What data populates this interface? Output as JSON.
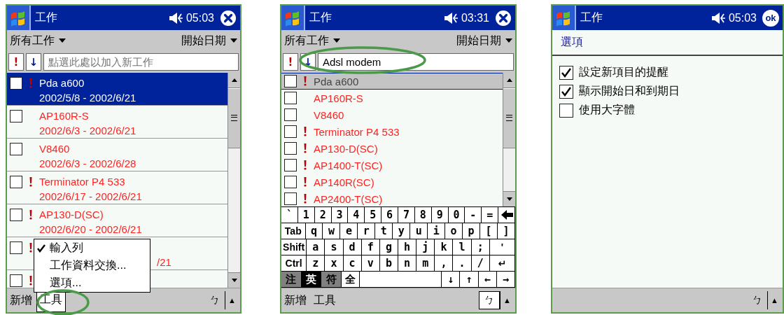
{
  "screens": [
    {
      "kind": "task-list",
      "list_active": true,
      "title_bar": {
        "title": "工作",
        "time": "05:03",
        "button": {
          "kind": "close"
        }
      },
      "filter_bar": {
        "category": "所有工作",
        "sort": "開始日期"
      },
      "entry_bar": {
        "priority_button": "!",
        "sort_button": "↓",
        "input": {
          "placeholder": "點選此處以加入新工作"
        }
      },
      "tasks": [
        {
          "kind": "full",
          "name": "Pda a600",
          "dates": "2002/5/8 - 2002/6/21",
          "important": true,
          "overdue": false,
          "checked": false,
          "selected": true
        },
        {
          "kind": "full",
          "name": "AP160R-S",
          "dates": "2002/6/3 - 2002/6/21",
          "important": false,
          "overdue": true,
          "checked": false,
          "selected": false
        },
        {
          "kind": "full",
          "name": "V8460",
          "dates": "2002/6/3 - 2002/6/28",
          "important": false,
          "overdue": true,
          "checked": false,
          "selected": false
        },
        {
          "kind": "full",
          "name": "Terminator P4 533",
          "dates": "2002/6/17 - 2002/6/21",
          "important": true,
          "overdue": true,
          "checked": false,
          "selected": false
        },
        {
          "kind": "full",
          "name": "AP130-D(SC)",
          "dates": "2002/6/20 - 2002/6/21",
          "important": true,
          "overdue": true,
          "checked": false,
          "selected": false
        },
        {
          "kind": "covered",
          "dates": "/21",
          "important": true,
          "overdue": true,
          "checked": false,
          "selected": false
        },
        {
          "kind": "covered",
          "important": true,
          "checked": false,
          "selected": false
        }
      ],
      "menu": {
        "items": [
          {
            "label": "輸入列",
            "checked": true
          },
          {
            "label": "工作資料交換...",
            "checked": false
          },
          {
            "label": "選項...",
            "checked": false
          }
        ]
      },
      "command_bar": {
        "items": [
          {
            "label": "新增",
            "selected": false
          },
          {
            "label": "工具",
            "selected": true
          }
        ],
        "input_button": {
          "label": "ㄅ",
          "selected": false
        },
        "arrow_button": "▲",
        "circled": true
      }
    },
    {
      "kind": "task-list",
      "list_active": false,
      "title_bar": {
        "title": "工作",
        "time": "03:31",
        "button": {
          "kind": "close"
        }
      },
      "filter_bar": {
        "category": "所有工作",
        "sort": "開始日期"
      },
      "entry_bar": {
        "priority_button": "!",
        "sort_button": "↓",
        "input": {
          "value": "Adsl modem"
        },
        "circled": true
      },
      "tasks": [
        {
          "kind": "full",
          "name": "Pda a600",
          "important": true,
          "overdue": false,
          "checked": false,
          "selected": true
        },
        {
          "kind": "full",
          "name": "AP160R-S",
          "important": false,
          "overdue": true,
          "checked": false,
          "selected": false
        },
        {
          "kind": "full",
          "name": "V8460",
          "important": false,
          "overdue": true,
          "checked": false,
          "selected": false
        },
        {
          "kind": "full",
          "name": "Terminator P4 533",
          "important": true,
          "overdue": true,
          "checked": false,
          "selected": false
        },
        {
          "kind": "full",
          "name": "AP130-D(SC)",
          "important": true,
          "overdue": true,
          "checked": false,
          "selected": false
        },
        {
          "kind": "full",
          "name": "AP1400-T(SC)",
          "important": true,
          "overdue": true,
          "checked": false,
          "selected": false
        },
        {
          "kind": "full",
          "name": "AP140R(SC)",
          "important": true,
          "overdue": true,
          "checked": false,
          "selected": false
        },
        {
          "kind": "full",
          "name": "AP2400-T(SC)",
          "important": true,
          "overdue": true,
          "checked": false,
          "selected": false
        }
      ],
      "keyboard": {
        "rows": [
          {
            "keys": [
              {
                "kind": "key",
                "label": "`"
              },
              {
                "kind": "key",
                "label": "1"
              },
              {
                "kind": "key",
                "label": "2"
              },
              {
                "kind": "key",
                "label": "3"
              },
              {
                "kind": "key",
                "label": "4"
              },
              {
                "kind": "key",
                "label": "5"
              },
              {
                "kind": "key",
                "label": "6"
              },
              {
                "kind": "key",
                "label": "7"
              },
              {
                "kind": "key",
                "label": "8"
              },
              {
                "kind": "key",
                "label": "9"
              },
              {
                "kind": "key",
                "label": "0"
              },
              {
                "kind": "key",
                "label": "-"
              },
              {
                "kind": "key",
                "label": "="
              },
              {
                "kind": "backspace"
              }
            ]
          },
          {
            "keys": [
              {
                "kind": "wide",
                "label": "Tab"
              },
              {
                "kind": "key",
                "label": "q"
              },
              {
                "kind": "key",
                "label": "w"
              },
              {
                "kind": "key",
                "label": "e"
              },
              {
                "kind": "key",
                "label": "r"
              },
              {
                "kind": "key",
                "label": "t"
              },
              {
                "kind": "key",
                "label": "y"
              },
              {
                "kind": "key",
                "label": "u"
              },
              {
                "kind": "key",
                "label": "i"
              },
              {
                "kind": "key",
                "label": "o"
              },
              {
                "kind": "key",
                "label": "p"
              },
              {
                "kind": "key",
                "label": "["
              },
              {
                "kind": "key",
                "label": "]"
              }
            ]
          },
          {
            "keys": [
              {
                "kind": "wide",
                "label": "Shift"
              },
              {
                "kind": "key",
                "label": "a"
              },
              {
                "kind": "key",
                "label": "s"
              },
              {
                "kind": "key",
                "label": "d"
              },
              {
                "kind": "key",
                "label": "f"
              },
              {
                "kind": "key",
                "label": "g"
              },
              {
                "kind": "key",
                "label": "h"
              },
              {
                "kind": "key",
                "label": "j"
              },
              {
                "kind": "key",
                "label": "k"
              },
              {
                "kind": "key",
                "label": "l"
              },
              {
                "kind": "key",
                "label": ";"
              },
              {
                "kind": "wide",
                "label": "'"
              }
            ]
          },
          {
            "keys": [
              {
                "kind": "wide",
                "label": "Ctrl"
              },
              {
                "kind": "key",
                "label": "z"
              },
              {
                "kind": "key",
                "label": "x"
              },
              {
                "kind": "key",
                "label": "c"
              },
              {
                "kind": "key",
                "label": "v"
              },
              {
                "kind": "key",
                "label": "b"
              },
              {
                "kind": "key",
                "label": "n"
              },
              {
                "kind": "key",
                "label": "m"
              },
              {
                "kind": "key",
                "label": ","
              },
              {
                "kind": "key",
                "label": "."
              },
              {
                "kind": "key",
                "label": "/"
              },
              {
                "kind": "wide",
                "label": "↵"
              }
            ]
          },
          {
            "keys": [
              {
                "kind": "mode",
                "label": "注",
                "selected": false
              },
              {
                "kind": "mode",
                "label": "英",
                "selected": true
              },
              {
                "kind": "mode",
                "label": "符",
                "selected": false
              },
              {
                "kind": "key",
                "label": "全"
              },
              {
                "kind": "space"
              },
              {
                "kind": "key",
                "label": "↓"
              },
              {
                "kind": "key",
                "label": "↑"
              },
              {
                "kind": "key",
                "label": "←"
              },
              {
                "kind": "key",
                "label": "→"
              }
            ]
          }
        ]
      },
      "command_bar": {
        "items": [
          {
            "label": "新增",
            "selected": false
          },
          {
            "label": "工具",
            "selected": false
          }
        ],
        "input_button": {
          "label": "ㄅ",
          "selected": true
        },
        "arrow_button": "▲"
      }
    },
    {
      "kind": "options",
      "title_bar": {
        "title": "工作",
        "time": "05:03",
        "button": {
          "kind": "ok",
          "label": "ok"
        }
      },
      "heading": "選項",
      "options": [
        {
          "label": "設定新項目的提醒",
          "checked": true
        },
        {
          "label": "顯示開始日和到期日",
          "checked": true
        },
        {
          "label": "使用大字體",
          "checked": false
        }
      ],
      "command_bar": {
        "input_button": {
          "label": "ㄅ",
          "selected": false
        },
        "arrow_button": "▲"
      }
    }
  ]
}
